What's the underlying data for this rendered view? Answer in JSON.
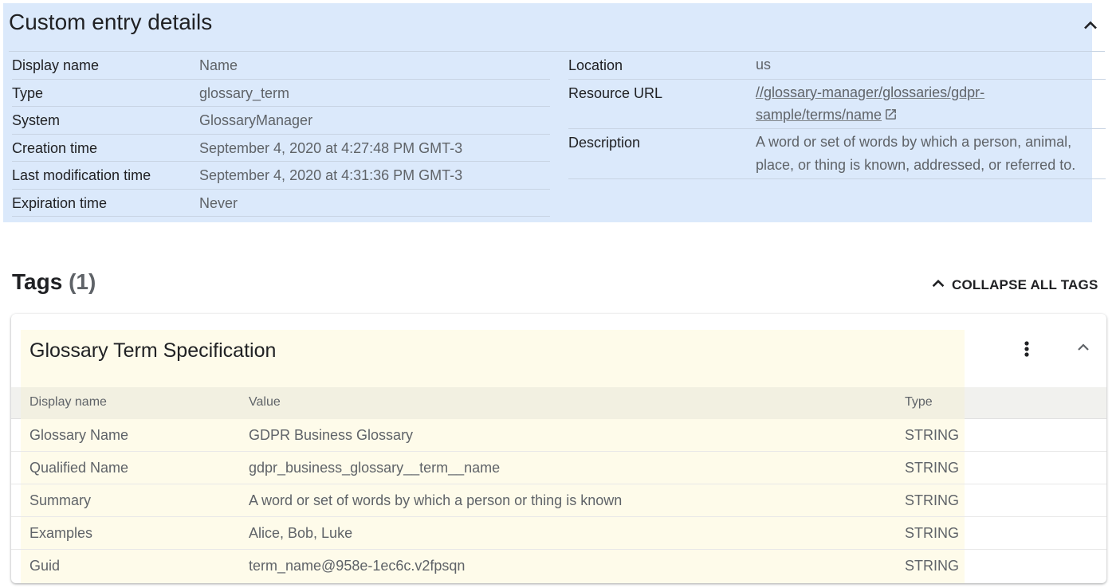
{
  "details": {
    "title": "Custom entry details",
    "left_fields": [
      {
        "label": "Display name",
        "value": "Name"
      },
      {
        "label": "Type",
        "value": "glossary_term"
      },
      {
        "label": "System",
        "value": "GlossaryManager"
      },
      {
        "label": "Creation time",
        "value": "September 4, 2020 at 4:27:48 PM GMT-3"
      },
      {
        "label": "Last modification time",
        "value": "September 4, 2020 at 4:31:36 PM GMT-3"
      },
      {
        "label": "Expiration time",
        "value": "Never"
      }
    ],
    "location": {
      "label": "Location",
      "value": "us"
    },
    "resource_url": {
      "label": "Resource URL",
      "line1": "//glossary-manager/glossaries/gdpr-",
      "line2": "sample/terms/name"
    },
    "description": {
      "label": "Description",
      "line1": "A word or set of words by which a person, animal,",
      "line2": "place, or thing is known, addressed, or referred to."
    }
  },
  "tags": {
    "title": "Tags",
    "count": "(1)",
    "collapse_all_label": "COLLAPSE ALL TAGS"
  },
  "tag_card": {
    "title": "Glossary Term Specification",
    "columns": [
      "Display name",
      "Value",
      "Type"
    ],
    "rows": [
      [
        "Glossary Name",
        "GDPR Business Glossary",
        "STRING"
      ],
      [
        "Qualified Name",
        "gdpr_business_glossary__term__name",
        "STRING"
      ],
      [
        "Summary",
        "A word or set of words by which a person or thing is known",
        "STRING"
      ],
      [
        "Examples",
        "Alice, Bob, Luke",
        "STRING"
      ],
      [
        "Guid",
        "term_name@958e-1ec6c.v2fpsqn",
        "STRING"
      ]
    ]
  },
  "icons": {
    "details_collapse": "chevron-up-icon",
    "external_link": "open-in-new-icon",
    "collapse_all": "chevron-up-icon",
    "card_menu": "more-vert-icon",
    "card_collapse": "chevron-up-icon"
  },
  "colors": {
    "details_highlight": "#dbe9fb",
    "card_highlight": "#fefbea",
    "text_primary": "#202124",
    "text_secondary": "#5f6368"
  }
}
